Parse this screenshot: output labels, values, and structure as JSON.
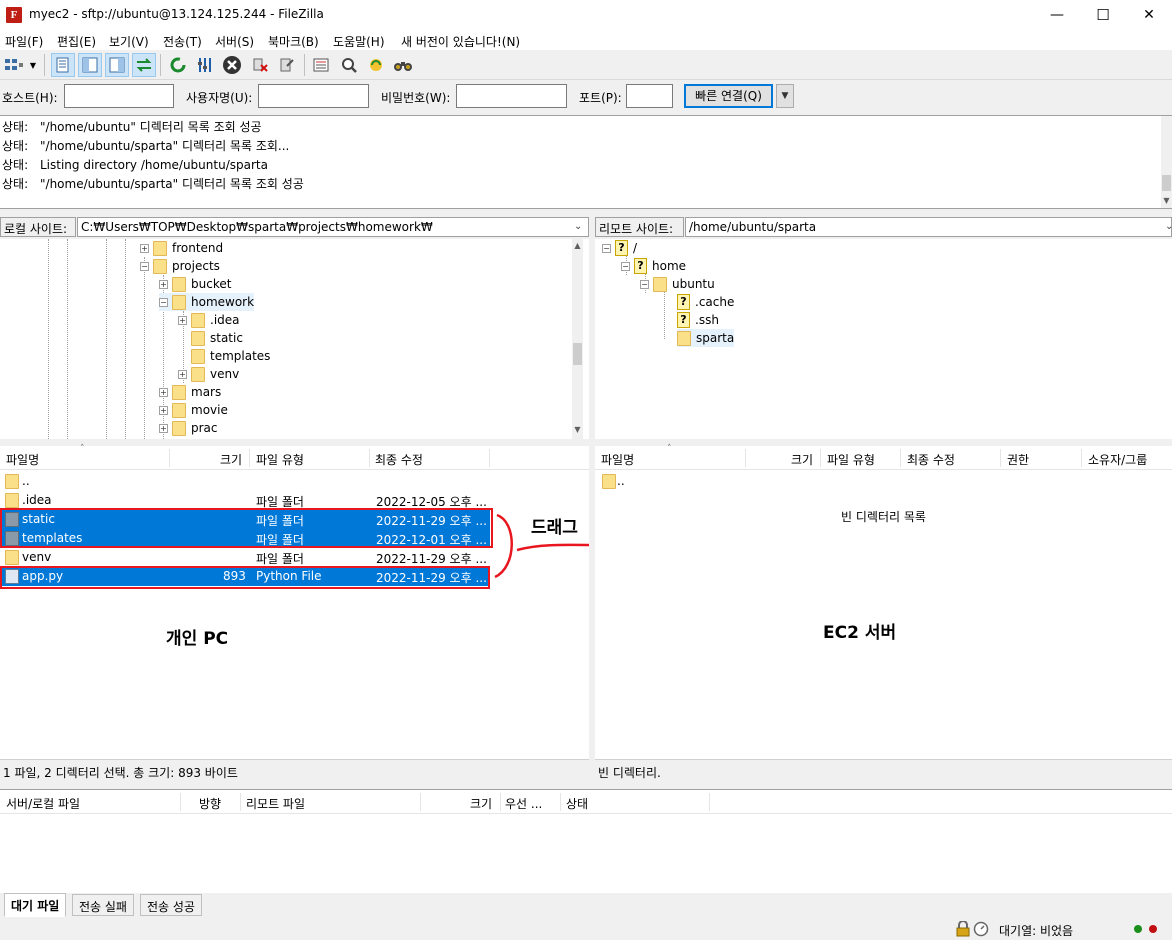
{
  "window": {
    "title": "myec2 - sftp://ubuntu@13.124.125.244 - FileZilla",
    "app_icon_letter": "F",
    "minimize_glyph": "—",
    "maximize_glyph": "☐",
    "close_glyph": "✕"
  },
  "menu": [
    "파일(F)",
    "편집(E)",
    "보기(V)",
    "전송(T)",
    "서버(S)",
    "북마크(B)",
    "도움말(H)",
    "새 버전이 있습니다!(N)"
  ],
  "toolbar": {
    "icons": [
      "site-manager-icon",
      "dropdown-icon",
      "toggle-log-icon",
      "toggle-local-tree-icon",
      "toggle-remote-tree-icon",
      "toggle-queue-icon",
      "refresh-icon",
      "process-queue-icon",
      "cancel-icon",
      "disconnect-icon",
      "reconnect-icon",
      "filter-icon",
      "search-icon",
      "sync-browse-icon",
      "binoculars-icon"
    ]
  },
  "quickconnect": {
    "host_label": "호스트(H):",
    "user_label": "사용자명(U):",
    "pass_label": "비밀번호(W):",
    "port_label": "포트(P):",
    "host_value": "",
    "user_value": "",
    "pass_value": "",
    "port_value": "",
    "connect_label": "빠른 연결(Q)",
    "dropdown_glyph": "▼"
  },
  "log": [
    {
      "label": "상태:",
      "text": "\"/home/ubuntu\" 디렉터리 목록 조회 성공"
    },
    {
      "label": "상태:",
      "text": "\"/home/ubuntu/sparta\" 디렉터리 목록 조회..."
    },
    {
      "label": "상태:",
      "text": "Listing directory /home/ubuntu/sparta"
    },
    {
      "label": "상태:",
      "text": "\"/home/ubuntu/sparta\" 디렉터리 목록 조회 성공"
    }
  ],
  "local": {
    "site_label": "로컬 사이트:",
    "site_path": "C:₩Users₩TOP₩Desktop₩sparta₩projects₩homework₩",
    "tree": [
      {
        "name": "frontend",
        "expander": "+"
      },
      {
        "name": "projects",
        "expander": "−"
      },
      {
        "name": "bucket",
        "expander": "+"
      },
      {
        "name": "homework",
        "expander": "−"
      },
      {
        "name": ".idea",
        "expander": "+"
      },
      {
        "name": "static",
        "expander": ""
      },
      {
        "name": "templates",
        "expander": ""
      },
      {
        "name": "venv",
        "expander": "+"
      },
      {
        "name": "mars",
        "expander": "+"
      },
      {
        "name": "movie",
        "expander": "+"
      },
      {
        "name": "prac",
        "expander": "+"
      }
    ],
    "columns": [
      "파일명",
      "크기",
      "파일 유형",
      "최종 수정"
    ],
    "files": [
      {
        "name": "..",
        "size": "",
        "type": "",
        "modified": "",
        "selected": false,
        "kind": "folder"
      },
      {
        "name": ".idea",
        "size": "",
        "type": "파일 폴더",
        "modified": "2022-12-05 오후 ...",
        "selected": false,
        "kind": "folder"
      },
      {
        "name": "static",
        "size": "",
        "type": "파일 폴더",
        "modified": "2022-11-29 오후 ...",
        "selected": true,
        "kind": "folder"
      },
      {
        "name": "templates",
        "size": "",
        "type": "파일 폴더",
        "modified": "2022-12-01 오후 ...",
        "selected": true,
        "kind": "folder"
      },
      {
        "name": "venv",
        "size": "",
        "type": "파일 폴더",
        "modified": "2022-11-29 오후 ...",
        "selected": false,
        "kind": "folder"
      },
      {
        "name": "app.py",
        "size": "893",
        "type": "Python File",
        "modified": "2022-11-29 오후 ...",
        "selected": true,
        "kind": "file"
      }
    ],
    "status": "1 파일, 2 디렉터리 선택. 총 크기: 893 바이트"
  },
  "remote": {
    "site_label": "리모트 사이트:",
    "site_path": "/home/ubuntu/sparta",
    "tree": [
      {
        "name": "/",
        "expander": "−",
        "icon": "question"
      },
      {
        "name": "home",
        "expander": "−",
        "icon": "question"
      },
      {
        "name": "ubuntu",
        "expander": "−",
        "icon": "folder"
      },
      {
        "name": ".cache",
        "expander": "",
        "icon": "question"
      },
      {
        "name": ".ssh",
        "expander": "",
        "icon": "question"
      },
      {
        "name": "sparta",
        "expander": "",
        "icon": "folder"
      }
    ],
    "columns": [
      "파일명",
      "크기",
      "파일 유형",
      "최종 수정",
      "권한",
      "소유자/그룹"
    ],
    "files": [
      {
        "name": ".."
      }
    ],
    "empty_message": "빈 디렉터리 목록",
    "status": "빈 디렉터리."
  },
  "annotations": {
    "drag": "드래그",
    "local_pc": "개인 PC",
    "ec2": "EC2 서버"
  },
  "queue": {
    "columns": [
      "서버/로컬 파일",
      "방향",
      "리모트 파일",
      "크기",
      "우선 ...",
      "상태"
    ]
  },
  "tabs": [
    {
      "label": "대기 파일",
      "active": true
    },
    {
      "label": "전송 실패",
      "active": false
    },
    {
      "label": "전송 성공",
      "active": false
    }
  ],
  "bottom": {
    "queue_status": "대기열: 비었음"
  },
  "colors": {
    "selection": "#0078d7",
    "annotation_red": "#e8161f"
  }
}
